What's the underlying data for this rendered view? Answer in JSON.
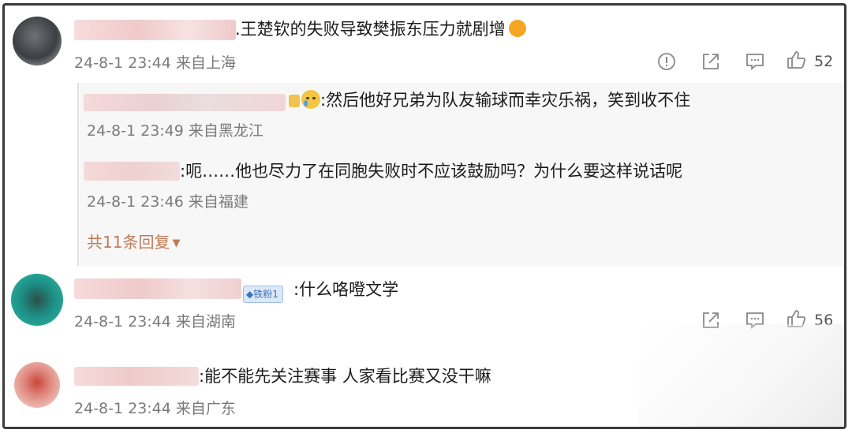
{
  "comments": [
    {
      "text": ".王楚钦的失败导致樊振东压力就剧增",
      "meta": "24-8-1 23:44 来自上海",
      "likes": "52"
    },
    {
      "text": ":什么咯噔文学",
      "badge": "铁粉1",
      "meta": "24-8-1 23:44 来自湖南",
      "likes": "56"
    },
    {
      "text": ":能不能先关注赛事 人家看比赛又没干嘛",
      "meta": "24-8-1 23:44 来自广东"
    }
  ],
  "replies": [
    {
      "text": ":然后他好兄弟为队友输球而幸灾乐祸，笑到收不住",
      "meta": "24-8-1 23:49 来自黑龙江"
    },
    {
      "text": ":呃……他也尽力了在同胞失败时不应该鼓励吗？为什么要这样说话呢",
      "meta": "24-8-1 23:46 来自福建"
    }
  ],
  "more_replies": "共11条回复",
  "icons": {
    "report": "report-icon",
    "share": "share-icon",
    "comment": "comment-icon",
    "like": "like-icon"
  },
  "colors": {
    "more_link": "#c07a56",
    "meta": "#7a7a7a"
  }
}
